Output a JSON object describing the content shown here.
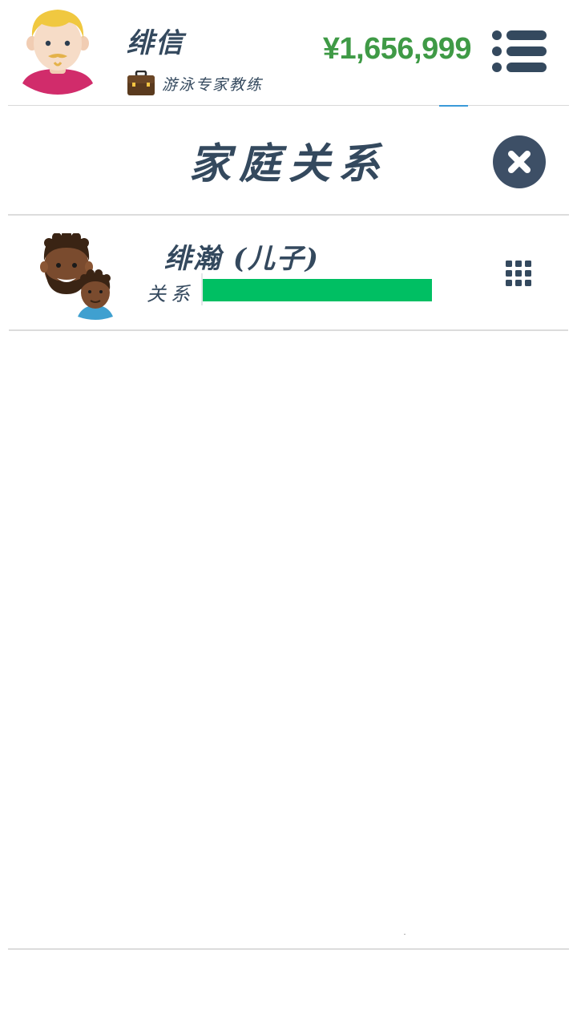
{
  "header": {
    "player_name": "绯信",
    "job_title": "游泳专家教练",
    "money": "¥1,656,999",
    "avatar_icon": "blonde-man-avatar-icon",
    "job_icon": "briefcase-icon",
    "menu_icon": "list-menu-icon"
  },
  "dialog": {
    "title": "家庭关系",
    "close_icon": "close-icon"
  },
  "relations": [
    {
      "name": "绯瀚 (儿子)",
      "relation_label": "关系",
      "relation_level": 1.0,
      "avatar_icon": "father-son-avatar-icon",
      "action_icon": "grid-menu-icon"
    }
  ],
  "colors": {
    "text_primary": "#34495e",
    "money_green": "#3f9a46",
    "relation_bar": "#00bf63",
    "divider": "#dcdcdc"
  }
}
